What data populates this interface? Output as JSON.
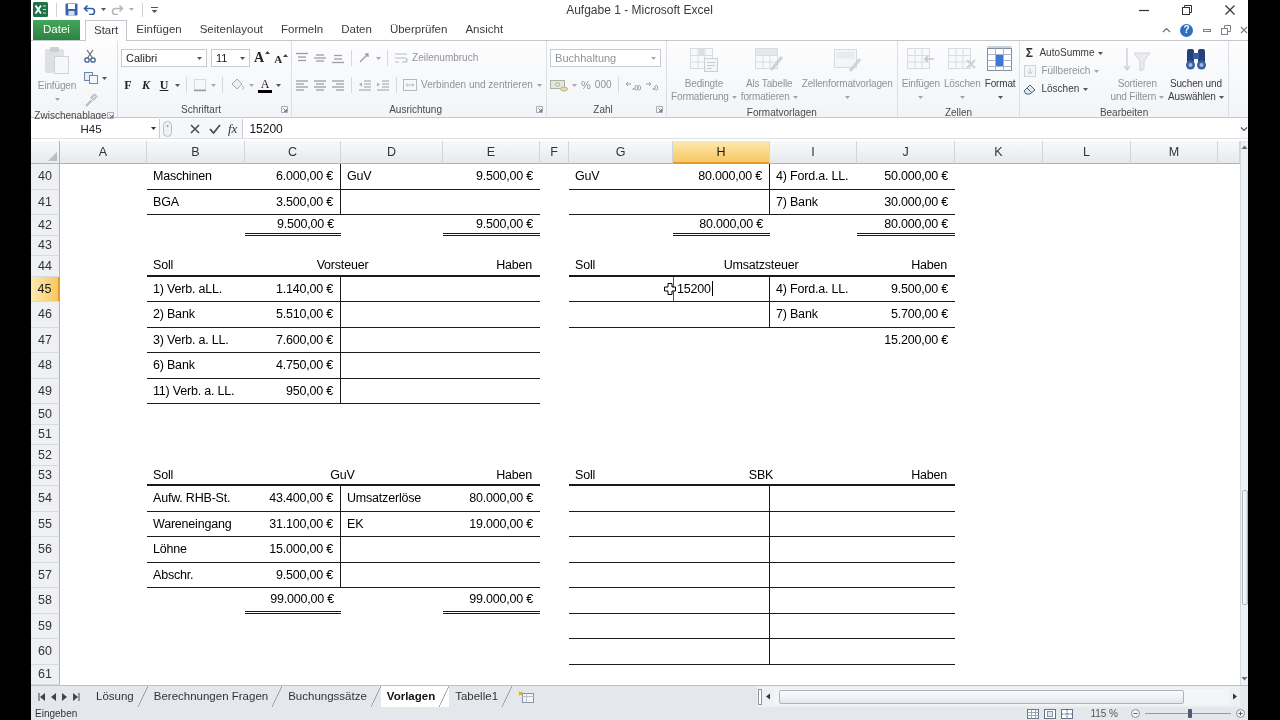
{
  "window": {
    "title": "Aufgabe 1 - Microsoft Excel",
    "help_button": "?"
  },
  "tabs": [
    {
      "label": "Datei",
      "kind": "file",
      "selected": false
    },
    {
      "label": "Start",
      "kind": "tab",
      "selected": true
    },
    {
      "label": "Einfügen",
      "kind": "tab",
      "selected": false
    },
    {
      "label": "Seitenlayout",
      "kind": "tab",
      "selected": false
    },
    {
      "label": "Formeln",
      "kind": "tab",
      "selected": false
    },
    {
      "label": "Daten",
      "kind": "tab",
      "selected": false
    },
    {
      "label": "Überprüfen",
      "kind": "tab",
      "selected": false
    },
    {
      "label": "Ansicht",
      "kind": "tab",
      "selected": false
    }
  ],
  "ribbon": {
    "groups": [
      {
        "kind": "clipboard",
        "label": "Zwischenablage",
        "paste": {
          "label": "Einfügen",
          "disabled": true
        }
      },
      {
        "kind": "font",
        "label": "Schriftart",
        "font_name": "Calibri",
        "font_size": "11",
        "grow": "A",
        "shrink": "A",
        "bold": "F",
        "italic": "K",
        "underline": "U",
        "font_color": "A"
      },
      {
        "kind": "alignment",
        "label": "Ausrichtung",
        "wrap_text": {
          "label": "Zeilenumbruch",
          "disabled": true
        },
        "merge": {
          "label": "Verbinden und zentrieren",
          "disabled": true
        }
      },
      {
        "kind": "number",
        "label": "Zahl",
        "format": {
          "value": "Buchhaltung",
          "disabled": true
        },
        "percent": {
          "label": "%",
          "disabled": true
        },
        "thousands": {
          "label": "000",
          "disabled": true
        }
      },
      {
        "kind": "large",
        "label": "Formatvorlagen",
        "buttons": [
          {
            "kind": "conditional",
            "lines": [
              "Bedingte",
              "Formatierung"
            ],
            "disabled": true
          },
          {
            "kind": "table",
            "lines": [
              "Als Tabelle",
              "formatieren"
            ],
            "disabled": true
          },
          {
            "kind": "styles",
            "lines": [
              "Zellenformatvorlagen"
            ],
            "disabled": true
          }
        ]
      },
      {
        "kind": "large",
        "label": "Zellen",
        "buttons": [
          {
            "kind": "insert",
            "lines": [
              "Einfügen"
            ],
            "disabled": true
          },
          {
            "kind": "delete",
            "lines": [
              "Löschen"
            ],
            "disabled": true
          },
          {
            "kind": "format",
            "lines": [
              "Format"
            ],
            "disabled": false
          }
        ]
      },
      {
        "kind": "editing",
        "label": "Bearbeiten",
        "small": [
          {
            "kind": "sum",
            "symbol": "Σ",
            "label": "AutoSumme",
            "disabled": false
          },
          {
            "kind": "fill",
            "label": "Füllbereich",
            "disabled": true
          },
          {
            "kind": "clear",
            "label": "Löschen",
            "disabled": false
          }
        ],
        "buttons": [
          {
            "kind": "sort",
            "lines": [
              "Sortieren",
              "und Filtern"
            ],
            "disabled": true
          },
          {
            "kind": "find",
            "lines": [
              "Suchen und",
              "Auswählen"
            ],
            "disabled": false
          }
        ]
      }
    ]
  },
  "formula_bar": {
    "name_box": "H45",
    "function_button": "fx",
    "formula": "15200"
  },
  "sheet": {
    "editing": true,
    "columns": [
      {
        "label": "A",
        "selected": false
      },
      {
        "label": "B",
        "selected": false
      },
      {
        "label": "C",
        "selected": false
      },
      {
        "label": "D",
        "selected": false
      },
      {
        "label": "E",
        "selected": false
      },
      {
        "label": "F",
        "selected": false
      },
      {
        "label": "G",
        "selected": false
      },
      {
        "label": "H",
        "selected": true
      },
      {
        "label": "I",
        "selected": false
      },
      {
        "label": "J",
        "selected": false
      },
      {
        "label": "K",
        "selected": false
      },
      {
        "label": "L",
        "selected": false
      },
      {
        "label": "M",
        "selected": false
      }
    ],
    "rows": [
      {
        "number": "40",
        "selected": false,
        "left": {
          "kind": "entry",
          "debit_label": "Maschinen",
          "debit_amount": "6.000,00 €",
          "credit_label": "GuV",
          "credit_amount": "9.500,00 €"
        },
        "right": {
          "kind": "entry",
          "debit_label": "GuV",
          "debit_amount": "80.000,00 €",
          "credit_label": "4) Ford.a. LL.",
          "credit_amount": "50.000,00 €"
        }
      },
      {
        "number": "41",
        "selected": false,
        "left": {
          "kind": "entry",
          "debit_label": "BGA",
          "debit_amount": "3.500,00 €"
        },
        "right": {
          "kind": "entry",
          "credit_label": "7) Bank",
          "credit_amount": "30.000,00 €"
        }
      },
      {
        "number": "42",
        "selected": false,
        "left": {
          "kind": "total",
          "debit_amount": "9.500,00 €",
          "credit_amount": "9.500,00 €"
        },
        "right": {
          "kind": "total",
          "debit_amount": "80.000,00 €",
          "credit_amount": "80.000,00 €"
        }
      },
      {
        "number": "43",
        "selected": false
      },
      {
        "number": "44",
        "selected": false,
        "left": {
          "kind": "header",
          "soll": "Soll",
          "title": "Vorsteuer",
          "haben": "Haben"
        },
        "right": {
          "kind": "header",
          "soll": "Soll",
          "title": "Umsatzsteuer",
          "haben": "Haben"
        }
      },
      {
        "number": "45",
        "selected": true,
        "left": {
          "kind": "entry",
          "debit_label": "1) Verb. aLL.",
          "debit_amount": "1.140,00 €"
        },
        "right": {
          "kind": "entry",
          "debit_amount": "15200",
          "credit_label": "4) Ford.a. LL.",
          "credit_amount": "9.500,00 €"
        }
      },
      {
        "number": "46",
        "selected": false,
        "left": {
          "kind": "entry",
          "debit_label": "2) Bank",
          "debit_amount": "5.510,00 €"
        },
        "right": {
          "kind": "entry",
          "credit_label": "7) Bank",
          "credit_amount": "5.700,00 €"
        }
      },
      {
        "number": "47",
        "selected": false,
        "left": {
          "kind": "entry",
          "debit_label": "3) Verb. a. LL.",
          "debit_amount": "7.600,00 €"
        },
        "right": {
          "kind": "plain",
          "credit_amount": "15.200,00 €"
        }
      },
      {
        "number": "48",
        "selected": false,
        "left": {
          "kind": "entry",
          "debit_label": "6) Bank",
          "debit_amount": "4.750,00 €"
        }
      },
      {
        "number": "49",
        "selected": false,
        "left": {
          "kind": "entry",
          "debit_label": "11) Verb. a. LL.",
          "debit_amount": "950,00 €"
        }
      },
      {
        "number": "50",
        "selected": false
      },
      {
        "number": "51",
        "selected": false
      },
      {
        "number": "52",
        "selected": false
      },
      {
        "number": "53",
        "selected": false,
        "left": {
          "kind": "header",
          "soll": "Soll",
          "title": "GuV",
          "haben": "Haben"
        },
        "right": {
          "kind": "header",
          "soll": "Soll",
          "title": "SBK",
          "haben": "Haben"
        }
      },
      {
        "number": "54",
        "selected": false,
        "left": {
          "kind": "entry",
          "debit_label": "Aufw. RHB-St.",
          "debit_amount": "43.400,00 €",
          "credit_label": "Umsatzerlöse",
          "credit_amount": "80.000,00 €"
        },
        "right": {
          "kind": "entry"
        }
      },
      {
        "number": "55",
        "selected": false,
        "left": {
          "kind": "entry",
          "debit_label": "Wareneingang",
          "debit_amount": "31.100,00 €",
          "credit_label": "EK",
          "credit_amount": "19.000,00 €"
        },
        "right": {
          "kind": "entry"
        }
      },
      {
        "number": "56",
        "selected": false,
        "left": {
          "kind": "entry",
          "debit_label": "Löhne",
          "debit_amount": "15.000,00 €"
        },
        "right": {
          "kind": "entry"
        }
      },
      {
        "number": "57",
        "selected": false,
        "left": {
          "kind": "entry",
          "debit_label": "Abschr.",
          "debit_amount": "9.500,00 €"
        },
        "right": {
          "kind": "entry"
        }
      },
      {
        "number": "58",
        "selected": false,
        "left": {
          "kind": "total",
          "debit_amount": "99.000,00 €",
          "credit_amount": "99.000,00 €"
        },
        "right": {
          "kind": "entry"
        }
      },
      {
        "number": "59",
        "selected": false,
        "right": {
          "kind": "entry"
        }
      },
      {
        "number": "60",
        "selected": false,
        "right": {
          "kind": "entry"
        }
      },
      {
        "number": "61",
        "selected": false
      }
    ]
  },
  "sheet_tabs": [
    {
      "label": "Lösung",
      "selected": false
    },
    {
      "label": "Berechnungen Fragen",
      "selected": false
    },
    {
      "label": "Buchungssätze",
      "selected": false
    },
    {
      "label": "Vorlagen",
      "selected": true
    },
    {
      "label": "Tabelle1",
      "selected": false
    }
  ],
  "status_bar": {
    "mode": "Eingeben",
    "zoom": {
      "reading": "115 %",
      "level": 0.52
    }
  }
}
